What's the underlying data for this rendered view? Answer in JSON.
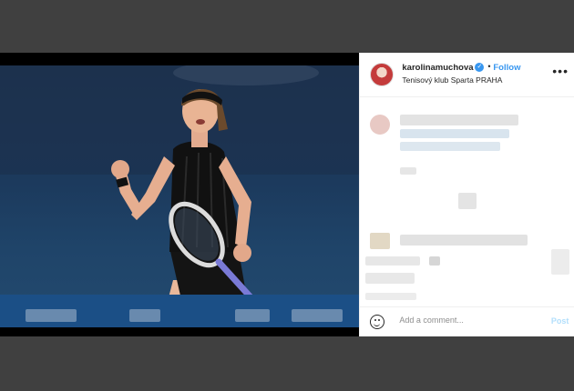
{
  "post": {
    "username": "karolinamuchova",
    "follow_label": "Follow",
    "separator": "•",
    "location": "Tenisový klub Sparta PRAHA",
    "more_label": "•••",
    "verified_mark": "✓"
  },
  "composer": {
    "placeholder": "Add a comment...",
    "post_label": "Post"
  },
  "colors": {
    "accent": "#3897f0",
    "post_disabled": "#b2dffc",
    "backdrop": "#404040"
  },
  "icons": {
    "verified": "verified-badge-icon",
    "more": "more-options-icon",
    "emoji": "emoji-smile-icon"
  }
}
